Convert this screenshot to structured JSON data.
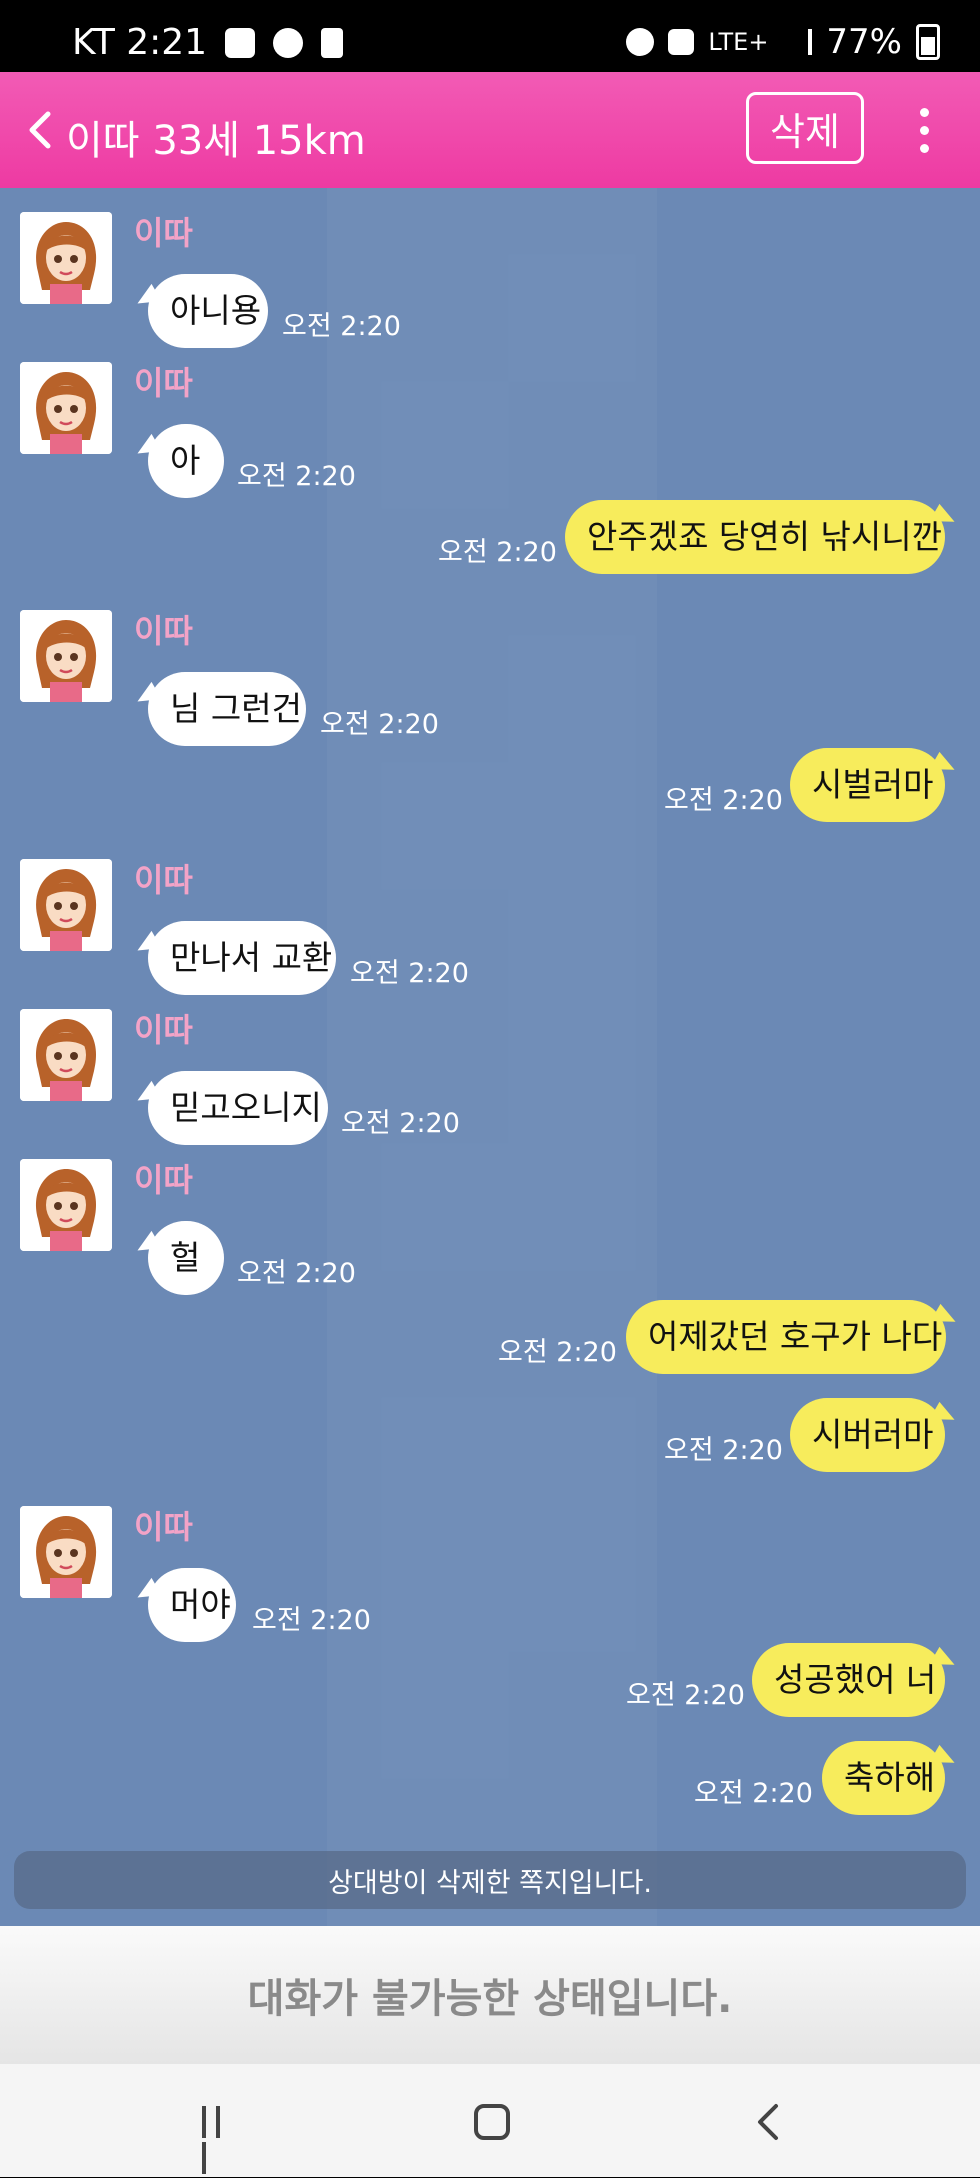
{
  "status_bar": {
    "carrier_time": "KT 2:21",
    "network": "LTE+",
    "battery": "77%"
  },
  "header": {
    "title": "이따 33세 15km",
    "delete_label": "삭제"
  },
  "messages": [
    {
      "side": "in",
      "sender": "이따",
      "text": "아니용",
      "time": "오전 2:20"
    },
    {
      "side": "in",
      "sender": "이따",
      "text": "아",
      "time": "오전 2:20"
    },
    {
      "side": "out",
      "text": "안주겠죠 당연히 낚시니깐",
      "time": "오전 2:20"
    },
    {
      "side": "in",
      "sender": "이따",
      "text": "님 그런건",
      "time": "오전 2:20"
    },
    {
      "side": "out",
      "text": "시벌러마",
      "time": "오전 2:20"
    },
    {
      "side": "in",
      "sender": "이따",
      "text": "만나서 교환",
      "time": "오전 2:20"
    },
    {
      "side": "in",
      "sender": "이따",
      "text": "믿고오니지",
      "time": "오전 2:20"
    },
    {
      "side": "in",
      "sender": "이따",
      "text": "헐",
      "time": "오전 2:20"
    },
    {
      "side": "out",
      "text": "어제갔던 호구가 나다",
      "time": "오전 2:20"
    },
    {
      "side": "out",
      "text": "시버러마",
      "time": "오전 2:20"
    },
    {
      "side": "in",
      "sender": "이따",
      "text": "머야",
      "time": "오전 2:20"
    },
    {
      "side": "out",
      "text": "성공했어 너",
      "time": "오전 2:20"
    },
    {
      "side": "out",
      "text": "축하해",
      "time": "오전 2:20"
    }
  ],
  "notice": "상대방이 삭제한 쪽지입니다.",
  "footer": "대화가 불가능한 상태입니다.",
  "colors": {
    "header": "#ee3aa2",
    "chat_bg": "#6b89b5",
    "out_bubble": "#f7ec5c",
    "in_bubble": "#ffffff",
    "sender": "#f3a3c7"
  }
}
